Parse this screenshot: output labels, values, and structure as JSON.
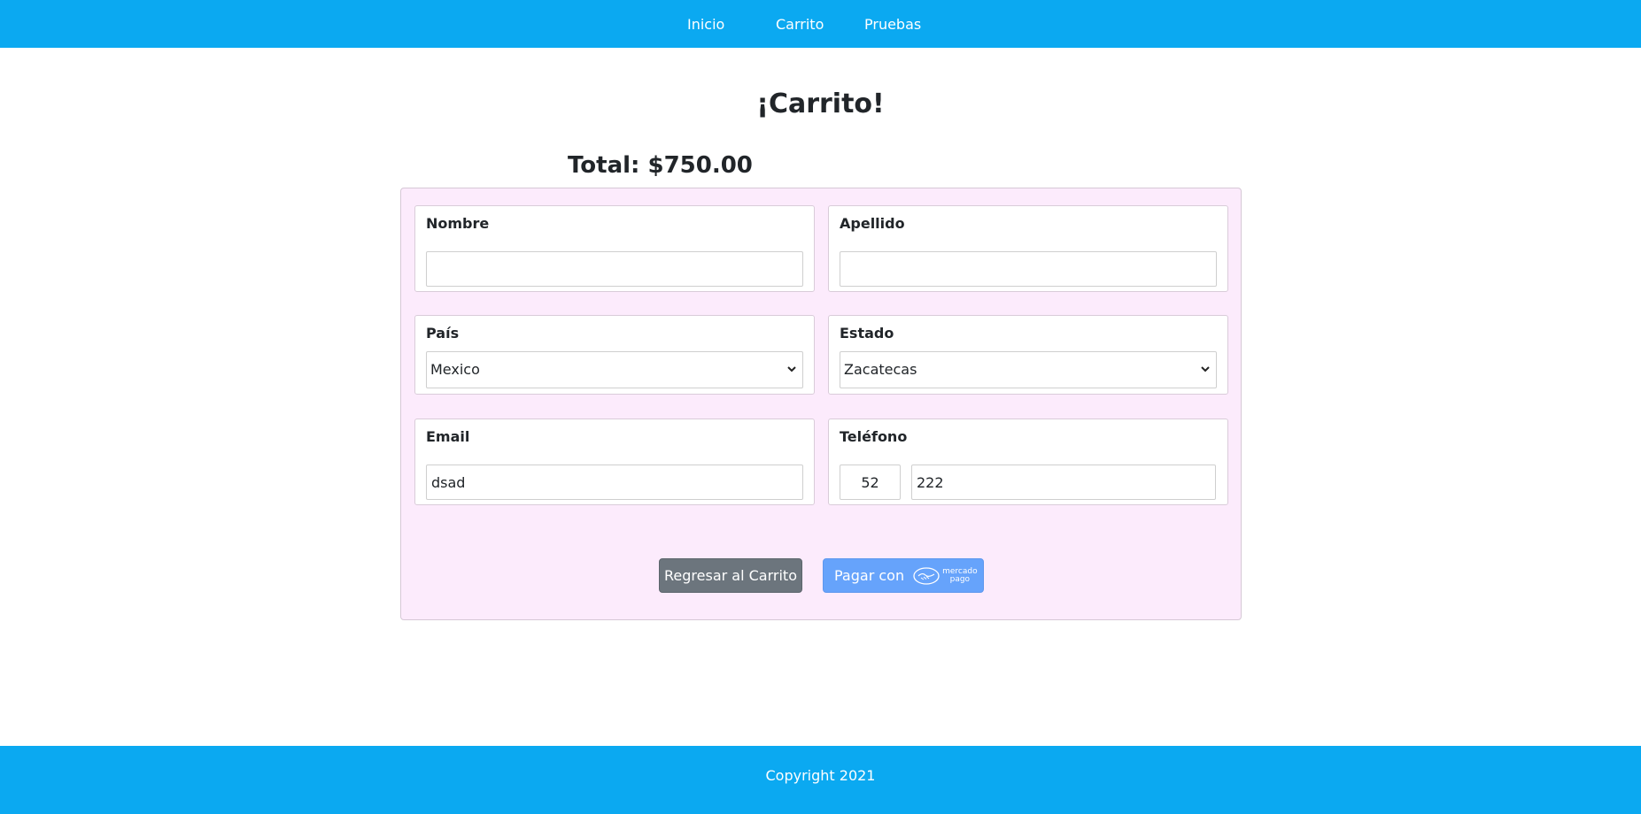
{
  "nav": {
    "links": [
      "Inicio",
      "Carrito",
      "Pruebas"
    ]
  },
  "page": {
    "title": "¡Carrito!",
    "total": "Total: $750.00"
  },
  "form": {
    "nombre": {
      "label": "Nombre",
      "value": ""
    },
    "apellido": {
      "label": "Apellido",
      "value": ""
    },
    "pais": {
      "label": "País",
      "selected": "Mexico"
    },
    "estado": {
      "label": "Estado",
      "selected": "Zacatecas"
    },
    "email": {
      "label": "Email",
      "value": "dsad"
    },
    "telefono": {
      "label": "Teléfono",
      "code": "52",
      "number": "222"
    }
  },
  "buttons": {
    "back": "Regresar al Carrito",
    "pay": "Pagar con",
    "brand_top": "mercado",
    "brand_bottom": "pago"
  },
  "footer": {
    "copyright": "Copyright 2021"
  },
  "colors": {
    "nav": "#0ba9f1",
    "panel": "#fcebfc",
    "back_button": "#6c757d",
    "pay_button": "#66a3fb"
  },
  "icons": {
    "select_arrow": "chevron-down-icon",
    "pay_brand": "handshake-icon"
  }
}
